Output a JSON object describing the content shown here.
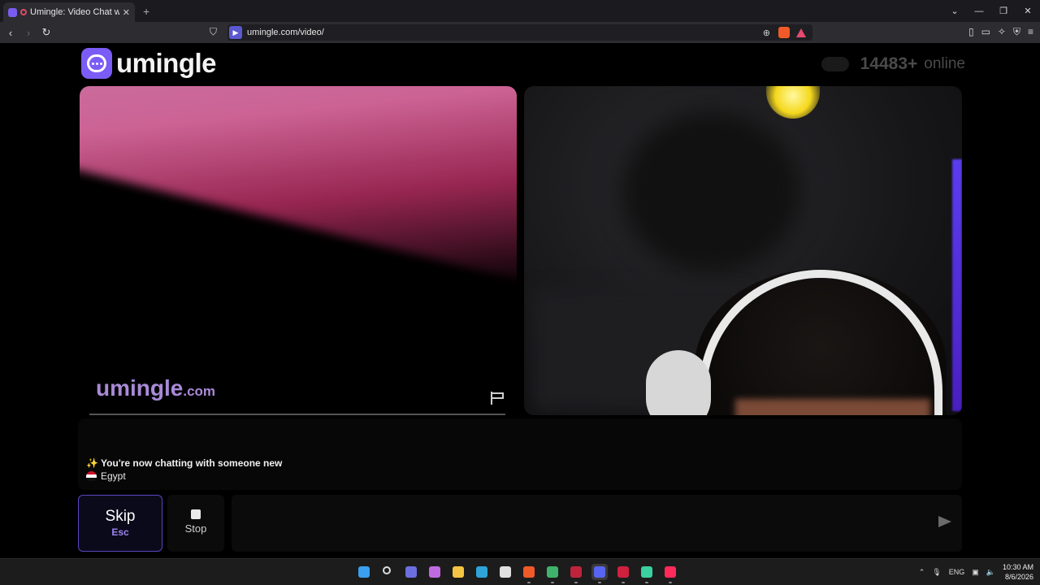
{
  "browser": {
    "tab_title": "Umingle: Video Chat with Str",
    "new_tab_symbol": "+",
    "url": "umingle.com/video/"
  },
  "header": {
    "logo_text": "umingle",
    "online_count": "14483+",
    "online_label": "online"
  },
  "video_left": {
    "watermark_main": "umingle",
    "watermark_suffix": ".com"
  },
  "chat": {
    "system_message": "✨ You're now chatting with someone new",
    "partner_country": "Egypt"
  },
  "controls": {
    "skip_label": "Skip",
    "skip_key": "Esc",
    "stop_label": "Stop",
    "message_placeholder": ""
  },
  "taskbar": {
    "language": "ENG",
    "time": "10:30 AM",
    "date": "8/6/2026",
    "apps": [
      {
        "name": "start-icon",
        "color": "#3aa0f0"
      },
      {
        "name": "search-icon",
        "color": "#dddddd"
      },
      {
        "name": "teams-icon",
        "color": "#6b6fe0"
      },
      {
        "name": "copilot-icon",
        "color": "#c06ae0"
      },
      {
        "name": "file-explorer-icon",
        "color": "#f4c542"
      },
      {
        "name": "edge-icon",
        "color": "#2fa4d8"
      },
      {
        "name": "store-icon",
        "color": "#e0e0e0"
      },
      {
        "name": "brave-icon",
        "color": "#f05a28"
      },
      {
        "name": "app-green-icon",
        "color": "#3fb36b"
      },
      {
        "name": "app-red-icon",
        "color": "#c0243c"
      },
      {
        "name": "discord-icon",
        "color": "#5865f2"
      },
      {
        "name": "app-crimson-icon",
        "color": "#d02040"
      },
      {
        "name": "app-teal-icon",
        "color": "#3ad0a0"
      },
      {
        "name": "tiktok-icon",
        "color": "#ff2a5a"
      }
    ]
  },
  "colors": {
    "accent": "#7c5cf6",
    "watermark": "#a98ad7",
    "skip_key": "#9c84f2"
  }
}
